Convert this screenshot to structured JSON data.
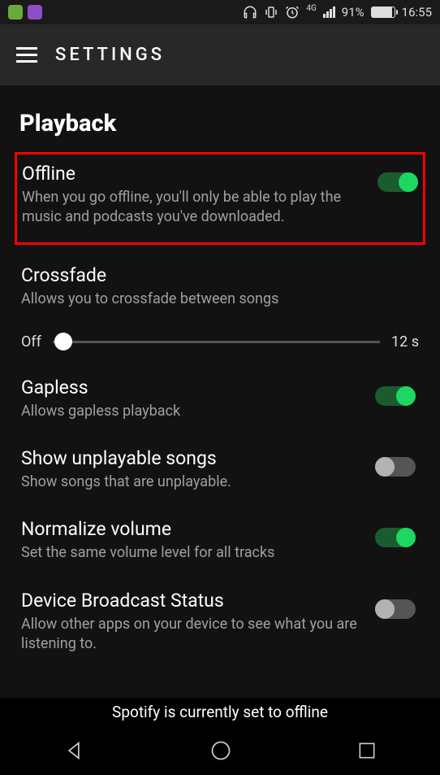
{
  "statusbar": {
    "network_label": "4G",
    "battery_pct": "91%",
    "time": "16:55"
  },
  "toolbar": {
    "title": "SETTINGS"
  },
  "section": {
    "title": "Playback"
  },
  "settings": {
    "offline": {
      "label": "Offline",
      "desc": "When you go offline, you'll only be able to play the music and podcasts you've downloaded.",
      "on": true
    },
    "crossfade": {
      "label": "Crossfade",
      "desc": "Allows you to crossfade between songs",
      "slider_min_label": "Off",
      "slider_max_label": "12 s",
      "slider_value": 0
    },
    "gapless": {
      "label": "Gapless",
      "desc": "Allows gapless playback",
      "on": true
    },
    "unplayable": {
      "label": "Show unplayable songs",
      "desc": "Show songs that are unplayable.",
      "on": false
    },
    "normalize": {
      "label": "Normalize volume",
      "desc": "Set the same volume level for all tracks",
      "on": true
    },
    "broadcast": {
      "label": "Device Broadcast Status",
      "desc": "Allow other apps on your device to see what you are listening to.",
      "on": false
    }
  },
  "banner": "Spotify is currently set to offline"
}
